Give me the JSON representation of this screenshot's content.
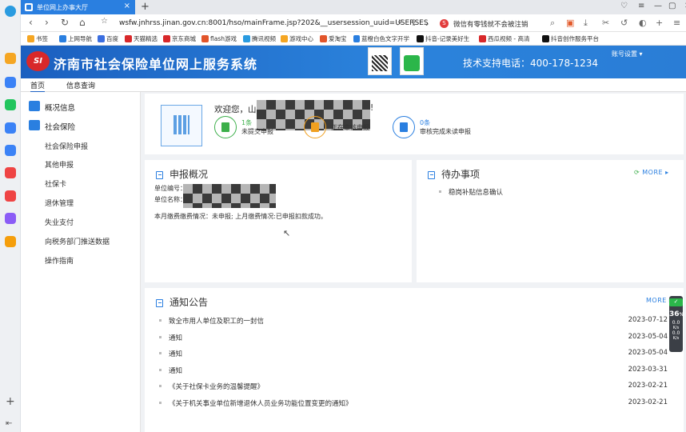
{
  "browser": {
    "tab_title": "单位网上办事大厅",
    "url": "wsfw.jnhrss.jinan.gov.cn:8001/hso/mainFrame.jsp?202&__usersession_uuid=USERSES",
    "search_text": "微信有零钱就不会被注销",
    "bookmarks": [
      "书签",
      "上网导航",
      "百度",
      "天猫精选",
      "京东商城",
      "flash游戏",
      "腾讯视频",
      "游戏中心",
      "爱淘宝",
      "蓝橙白色文字开学",
      "抖音-记录美好生",
      "西瓜视频 - 高清",
      "抖音创作服务平台"
    ]
  },
  "header": {
    "logo_text": "SI",
    "title": "济南市社会保险单位网上服务系统",
    "support_phone": "技术支持电话：400-178-1234",
    "account_settings": "账号设置 ▾"
  },
  "nav": {
    "home": "首页",
    "info_query": "信息查询"
  },
  "menu": {
    "overview": "概况信息",
    "social_insurance": "社会保险",
    "items": [
      "社会保险申报",
      "其他申报",
      "社保卡",
      "退休管理",
      "失业支付",
      "向税务部门推送数据",
      "操作指南"
    ]
  },
  "welcome": {
    "greeting": "欢迎您，山",
    "exclaim": "!",
    "stats": [
      {
        "count": "1条",
        "label": "未提交申报",
        "color": "#3caf4a"
      },
      {
        "count": "",
        "label": "正在审核申报",
        "color": "#f0a020"
      },
      {
        "count": "0条",
        "label": "审核完成未读申报",
        "color": "#2a7fe0"
      }
    ]
  },
  "declare": {
    "title": "申报概况",
    "unit_no_label": "单位编号：",
    "unit_no_value": "2",
    "unit_name_label": "单位名称：",
    "status": "本月缴费缴费情况：未申报; 上月缴费情况:已申报扣款成功。"
  },
  "todo": {
    "title": "待办事项",
    "more": "MORE",
    "items": [
      "稳岗补贴信息确认"
    ]
  },
  "notices": {
    "title": "通知公告",
    "more": "MORE",
    "rows": [
      {
        "title": "致全市用人单位及职工的一封信",
        "date": "2023-07-12"
      },
      {
        "title": "通知",
        "date": "2023-05-04"
      },
      {
        "title": "通知",
        "date": "2023-05-04"
      },
      {
        "title": "通知",
        "date": "2023-03-31"
      },
      {
        "title": "《关于社保卡业务的温馨提醒》",
        "date": "2023-02-21"
      },
      {
        "title": "《关于机关事业单位新增退休人员业务功能位置变更的通知》",
        "date": "2023-02-21"
      }
    ]
  },
  "float_widget": {
    "value": "36",
    "unit": "%",
    "rate1": "0.0",
    "rate2": "0.0",
    "rate_unit": "K/s"
  }
}
